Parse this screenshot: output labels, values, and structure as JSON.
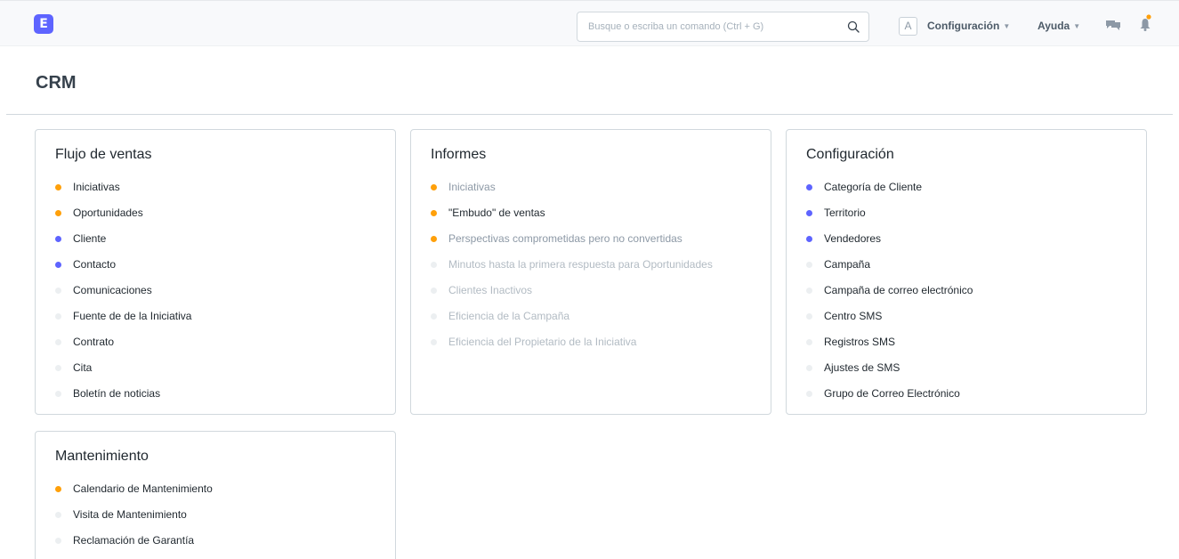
{
  "navbar": {
    "logo_letter": "E",
    "search_placeholder": "Busque o escriba un comando (Ctrl + G)",
    "avatar_letter": "A",
    "settings_label": "Configuración",
    "help_label": "Ayuda",
    "colors": {
      "brand": "#5e64ff",
      "notification": "#ffa00a"
    },
    "icons": [
      "search-icon",
      "chat-icon",
      "bell-icon"
    ]
  },
  "page": {
    "title": "CRM"
  },
  "cards": [
    {
      "title": "Flujo de ventas",
      "links": [
        {
          "label": "Iniciativas",
          "dot": "orange",
          "style": "dark"
        },
        {
          "label": "Oportunidades",
          "dot": "orange",
          "style": "dark"
        },
        {
          "label": "Cliente",
          "dot": "blue",
          "style": "dark"
        },
        {
          "label": "Contacto",
          "dot": "blue",
          "style": "dark"
        },
        {
          "label": "Comunicaciones",
          "dot": "grey",
          "style": "dark"
        },
        {
          "label": "Fuente de de la Iniciativa",
          "dot": "grey",
          "style": "dark"
        },
        {
          "label": "Contrato",
          "dot": "grey",
          "style": "dark"
        },
        {
          "label": "Cita",
          "dot": "grey",
          "style": "dark"
        },
        {
          "label": "Boletín de noticias",
          "dot": "grey",
          "style": "dark"
        }
      ]
    },
    {
      "title": "Informes",
      "links": [
        {
          "label": "Iniciativas",
          "dot": "orange",
          "style": "muted"
        },
        {
          "label": "\"Embudo\" de ventas",
          "dot": "orange",
          "style": "dark"
        },
        {
          "label": "Perspectivas comprometidas pero no convertidas",
          "dot": "orange",
          "style": "muted"
        },
        {
          "label": "Minutos hasta la primera respuesta para Oportunidades",
          "dot": "grey",
          "style": "light"
        },
        {
          "label": "Clientes Inactivos",
          "dot": "grey",
          "style": "light"
        },
        {
          "label": "Eficiencia de la Campaña",
          "dot": "grey",
          "style": "light"
        },
        {
          "label": "Eficiencia del Propietario de la Iniciativa",
          "dot": "grey",
          "style": "light"
        }
      ]
    },
    {
      "title": "Configuración",
      "links": [
        {
          "label": "Categoría de Cliente",
          "dot": "blue",
          "style": "dark"
        },
        {
          "label": "Territorio",
          "dot": "blue",
          "style": "dark"
        },
        {
          "label": "Vendedores",
          "dot": "blue",
          "style": "dark"
        },
        {
          "label": "Campaña",
          "dot": "grey",
          "style": "dark"
        },
        {
          "label": "Campaña de correo electrónico",
          "dot": "grey",
          "style": "dark"
        },
        {
          "label": "Centro SMS",
          "dot": "grey",
          "style": "dark"
        },
        {
          "label": "Registros SMS",
          "dot": "grey",
          "style": "dark"
        },
        {
          "label": "Ajustes de SMS",
          "dot": "grey",
          "style": "dark"
        },
        {
          "label": "Grupo de Correo Electrónico",
          "dot": "grey",
          "style": "dark"
        }
      ]
    },
    {
      "title": "Mantenimiento",
      "links": [
        {
          "label": "Calendario de Mantenimiento",
          "dot": "orange",
          "style": "dark"
        },
        {
          "label": "Visita de Mantenimiento",
          "dot": "grey",
          "style": "dark"
        },
        {
          "label": "Reclamación de Garantía",
          "dot": "grey",
          "style": "dark"
        }
      ]
    }
  ]
}
